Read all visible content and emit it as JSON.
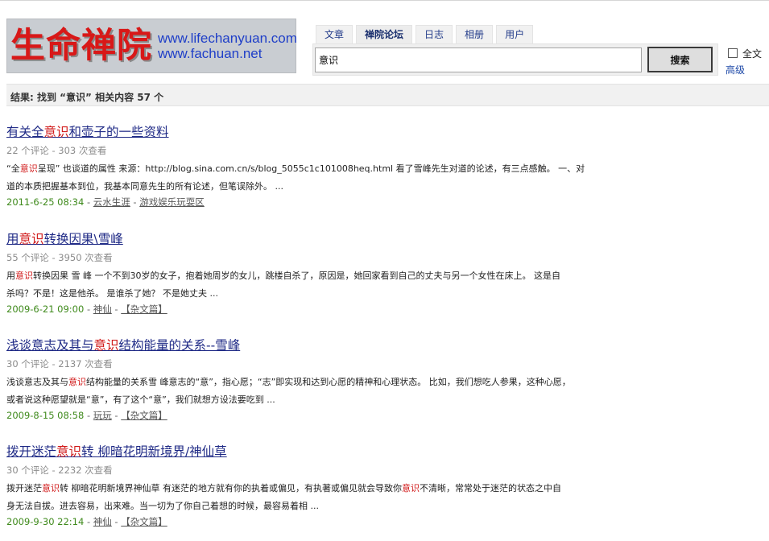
{
  "logo": {
    "name_cn": "生命禅院",
    "url1": "www.lifechanyuan.com",
    "url2": "www.fachuan.net"
  },
  "tabs": [
    {
      "label": "文章",
      "active": false
    },
    {
      "label": "禅院论坛",
      "active": true
    },
    {
      "label": "日志",
      "active": false
    },
    {
      "label": "相册",
      "active": false
    },
    {
      "label": "用户",
      "active": false
    }
  ],
  "search": {
    "value": "意识",
    "button_label": "搜索",
    "fulltext_label": "全文",
    "advanced_label": "高级"
  },
  "result_summary": "结果: 找到 “意识” 相关内容 57 个",
  "results": [
    {
      "title_pre": "有关全",
      "title_hl": "意识",
      "title_post": "和壶子的一些资料",
      "stats": "22 个评论 - 303 次查看",
      "snippet_line1_pre": "“全",
      "snippet_line1_hl": "意识",
      "snippet_line1_post": "呈现” 也谈道的属性 来源：http://blog.sina.com.cn/s/blog_5055c1c101008heq.html 看了雪峰先生对道的论述，有三点感触。 一、对",
      "snippet_line2": "道的本质把握基本到位，我基本同意先生的所有论述，但笔误除外。 ...",
      "date": "2011-6-25 08:34",
      "sep1": " - ",
      "author": "云水生涯",
      "sep2": " - ",
      "category": "游戏娱乐玩耍区"
    },
    {
      "title_pre": "用",
      "title_hl": "意识",
      "title_post": "转换因果\\雪峰",
      "stats": "55 个评论 - 3950 次查看",
      "snippet_line1_pre": "用",
      "snippet_line1_hl": "意识",
      "snippet_line1_post": "转换因果 雪 峰 一个不到30岁的女子，抱着她周岁的女儿，跳楼自杀了，原因是，她回家看到自己的丈夫与另一个女性在床上。 这是自",
      "snippet_line2": "杀吗？不是！这是他杀。 是谁杀了她？ 不是她丈夫 ...",
      "date": "2009-6-21 09:00",
      "sep1": " - ",
      "author": "神仙",
      "sep2": " - ",
      "category": "【杂文篇】"
    },
    {
      "title_pre": "浅谈意志及其与",
      "title_hl": "意识",
      "title_post": "结构能量的关系--雪峰",
      "stats": "30 个评论 - 2137 次查看",
      "snippet_line1_pre": "浅谈意志及其与",
      "snippet_line1_hl": "意识",
      "snippet_line1_post": "结构能量的关系雪 峰意志的“意”，指心愿；“志”即实现和达到心愿的精神和心理状态。 比如，我们想吃人参果，这种心愿，",
      "snippet_line2": "或者说这种愿望就是“意”，有了这个“意”，我们就想方设法要吃到 ...",
      "date": "2009-8-15 08:58",
      "sep1": " - ",
      "author": "玩玩",
      "sep2": " - ",
      "category": "【杂文篇】"
    },
    {
      "title_pre": "拨开迷茫",
      "title_hl": "意识",
      "title_post": "转 柳暗花明新境界/神仙草",
      "stats": "30 个评论 - 2232 次查看",
      "snippet_line1_pre": "拨开迷茫",
      "snippet_line1_hl": "意识",
      "snippet_line1_mid": "转 柳暗花明新境界神仙草 有迷茫的地方就有你的执着或偏见，有执著或偏见就会导致你",
      "snippet_line1_hl2": "意识",
      "snippet_line1_post": "不清晰，常常处于迷茫的状态之中自",
      "snippet_line2": "身无法自拔。进去容易，出来难。当一切为了你自己着想的时候，最容易着相 ...",
      "date": "2009-9-30 22:14",
      "sep1": " - ",
      "author": "神仙",
      "sep2": " - ",
      "category": "【杂文篇】"
    }
  ]
}
